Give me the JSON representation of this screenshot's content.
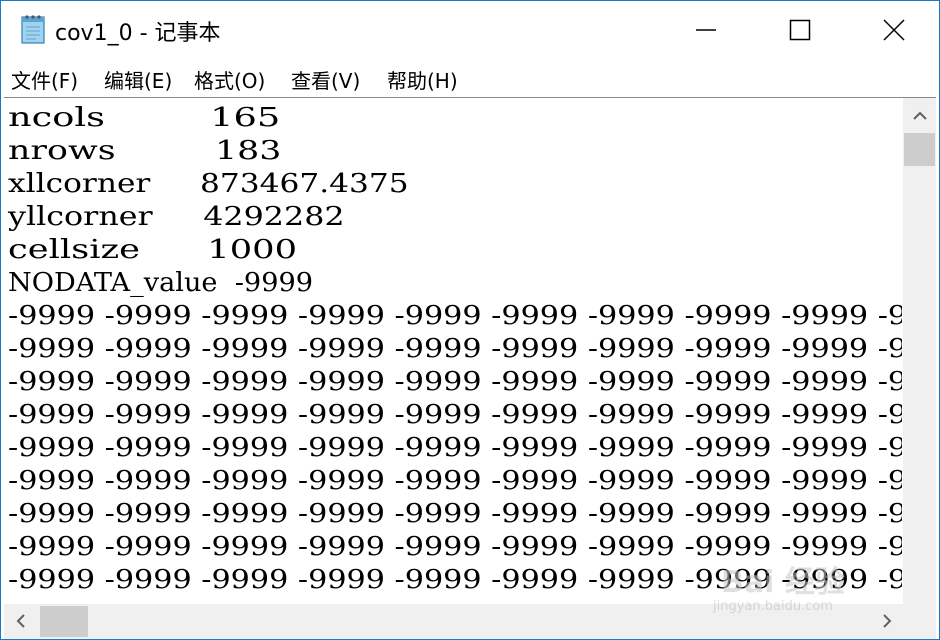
{
  "window": {
    "title": "cov1_0 - 记事本"
  },
  "menu": [
    {
      "label": "文件(F)"
    },
    {
      "label": "编辑(E)"
    },
    {
      "label": "格式(O)"
    },
    {
      "label": "查看(V)"
    },
    {
      "label": "帮助(H)"
    }
  ],
  "editor": {
    "lines": [
      "ncols         165",
      "nrows         183",
      "xllcorner     873467.4375",
      "yllcorner     4292282",
      "cellsize      1000",
      "NODATA_value  -9999",
      "-9999 -9999 -9999 -9999 -9999 -9999 -9999 -9999 -9999 -9",
      "-9999 -9999 -9999 -9999 -9999 -9999 -9999 -9999 -9999 -9",
      "-9999 -9999 -9999 -9999 -9999 -9999 -9999 -9999 -9999 -9",
      "-9999 -9999 -9999 -9999 -9999 -9999 -9999 -9999 -9999 -9",
      "-9999 -9999 -9999 -9999 -9999 -9999 -9999 -9999 -9999 -9",
      "-9999 -9999 -9999 -9999 -9999 -9999 -9999 -9999 -9999 -9",
      "-9999 -9999 -9999 -9999 -9999 -9999 -9999 -9999 -9999 -9",
      "-9999 -9999 -9999 -9999 -9999 -9999 -9999 -9999 -9999 -9",
      "-9999 -9999 -9999 -9999 -9999 -9999 -9999 -9999 -9999 -9"
    ]
  },
  "watermark": {
    "main": "Bai 经验",
    "sub": "jingyan.baidu.com"
  },
  "colors": {
    "window_border": "#1979ca",
    "scrollbar_track": "#f0f0f0",
    "scrollbar_thumb": "#cdcdcd"
  },
  "icons": {
    "app": "notepad-icon",
    "minimize": "minimize-icon",
    "maximize": "maximize-icon",
    "close": "close-icon"
  }
}
